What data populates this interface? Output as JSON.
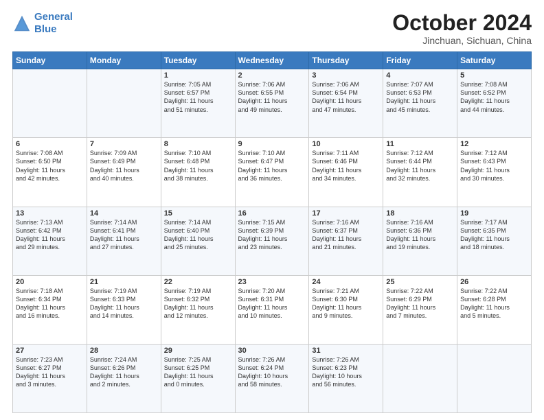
{
  "header": {
    "logo_line1": "General",
    "logo_line2": "Blue",
    "main_title": "October 2024",
    "subtitle": "Jinchuan, Sichuan, China"
  },
  "days_of_week": [
    "Sunday",
    "Monday",
    "Tuesday",
    "Wednesday",
    "Thursday",
    "Friday",
    "Saturday"
  ],
  "weeks": [
    [
      {
        "day": "",
        "info": ""
      },
      {
        "day": "",
        "info": ""
      },
      {
        "day": "1",
        "info": "Sunrise: 7:05 AM\nSunset: 6:57 PM\nDaylight: 11 hours\nand 51 minutes."
      },
      {
        "day": "2",
        "info": "Sunrise: 7:06 AM\nSunset: 6:55 PM\nDaylight: 11 hours\nand 49 minutes."
      },
      {
        "day": "3",
        "info": "Sunrise: 7:06 AM\nSunset: 6:54 PM\nDaylight: 11 hours\nand 47 minutes."
      },
      {
        "day": "4",
        "info": "Sunrise: 7:07 AM\nSunset: 6:53 PM\nDaylight: 11 hours\nand 45 minutes."
      },
      {
        "day": "5",
        "info": "Sunrise: 7:08 AM\nSunset: 6:52 PM\nDaylight: 11 hours\nand 44 minutes."
      }
    ],
    [
      {
        "day": "6",
        "info": "Sunrise: 7:08 AM\nSunset: 6:50 PM\nDaylight: 11 hours\nand 42 minutes."
      },
      {
        "day": "7",
        "info": "Sunrise: 7:09 AM\nSunset: 6:49 PM\nDaylight: 11 hours\nand 40 minutes."
      },
      {
        "day": "8",
        "info": "Sunrise: 7:10 AM\nSunset: 6:48 PM\nDaylight: 11 hours\nand 38 minutes."
      },
      {
        "day": "9",
        "info": "Sunrise: 7:10 AM\nSunset: 6:47 PM\nDaylight: 11 hours\nand 36 minutes."
      },
      {
        "day": "10",
        "info": "Sunrise: 7:11 AM\nSunset: 6:46 PM\nDaylight: 11 hours\nand 34 minutes."
      },
      {
        "day": "11",
        "info": "Sunrise: 7:12 AM\nSunset: 6:44 PM\nDaylight: 11 hours\nand 32 minutes."
      },
      {
        "day": "12",
        "info": "Sunrise: 7:12 AM\nSunset: 6:43 PM\nDaylight: 11 hours\nand 30 minutes."
      }
    ],
    [
      {
        "day": "13",
        "info": "Sunrise: 7:13 AM\nSunset: 6:42 PM\nDaylight: 11 hours\nand 29 minutes."
      },
      {
        "day": "14",
        "info": "Sunrise: 7:14 AM\nSunset: 6:41 PM\nDaylight: 11 hours\nand 27 minutes."
      },
      {
        "day": "15",
        "info": "Sunrise: 7:14 AM\nSunset: 6:40 PM\nDaylight: 11 hours\nand 25 minutes."
      },
      {
        "day": "16",
        "info": "Sunrise: 7:15 AM\nSunset: 6:39 PM\nDaylight: 11 hours\nand 23 minutes."
      },
      {
        "day": "17",
        "info": "Sunrise: 7:16 AM\nSunset: 6:37 PM\nDaylight: 11 hours\nand 21 minutes."
      },
      {
        "day": "18",
        "info": "Sunrise: 7:16 AM\nSunset: 6:36 PM\nDaylight: 11 hours\nand 19 minutes."
      },
      {
        "day": "19",
        "info": "Sunrise: 7:17 AM\nSunset: 6:35 PM\nDaylight: 11 hours\nand 18 minutes."
      }
    ],
    [
      {
        "day": "20",
        "info": "Sunrise: 7:18 AM\nSunset: 6:34 PM\nDaylight: 11 hours\nand 16 minutes."
      },
      {
        "day": "21",
        "info": "Sunrise: 7:19 AM\nSunset: 6:33 PM\nDaylight: 11 hours\nand 14 minutes."
      },
      {
        "day": "22",
        "info": "Sunrise: 7:19 AM\nSunset: 6:32 PM\nDaylight: 11 hours\nand 12 minutes."
      },
      {
        "day": "23",
        "info": "Sunrise: 7:20 AM\nSunset: 6:31 PM\nDaylight: 11 hours\nand 10 minutes."
      },
      {
        "day": "24",
        "info": "Sunrise: 7:21 AM\nSunset: 6:30 PM\nDaylight: 11 hours\nand 9 minutes."
      },
      {
        "day": "25",
        "info": "Sunrise: 7:22 AM\nSunset: 6:29 PM\nDaylight: 11 hours\nand 7 minutes."
      },
      {
        "day": "26",
        "info": "Sunrise: 7:22 AM\nSunset: 6:28 PM\nDaylight: 11 hours\nand 5 minutes."
      }
    ],
    [
      {
        "day": "27",
        "info": "Sunrise: 7:23 AM\nSunset: 6:27 PM\nDaylight: 11 hours\nand 3 minutes."
      },
      {
        "day": "28",
        "info": "Sunrise: 7:24 AM\nSunset: 6:26 PM\nDaylight: 11 hours\nand 2 minutes."
      },
      {
        "day": "29",
        "info": "Sunrise: 7:25 AM\nSunset: 6:25 PM\nDaylight: 11 hours\nand 0 minutes."
      },
      {
        "day": "30",
        "info": "Sunrise: 7:26 AM\nSunset: 6:24 PM\nDaylight: 10 hours\nand 58 minutes."
      },
      {
        "day": "31",
        "info": "Sunrise: 7:26 AM\nSunset: 6:23 PM\nDaylight: 10 hours\nand 56 minutes."
      },
      {
        "day": "",
        "info": ""
      },
      {
        "day": "",
        "info": ""
      }
    ]
  ]
}
